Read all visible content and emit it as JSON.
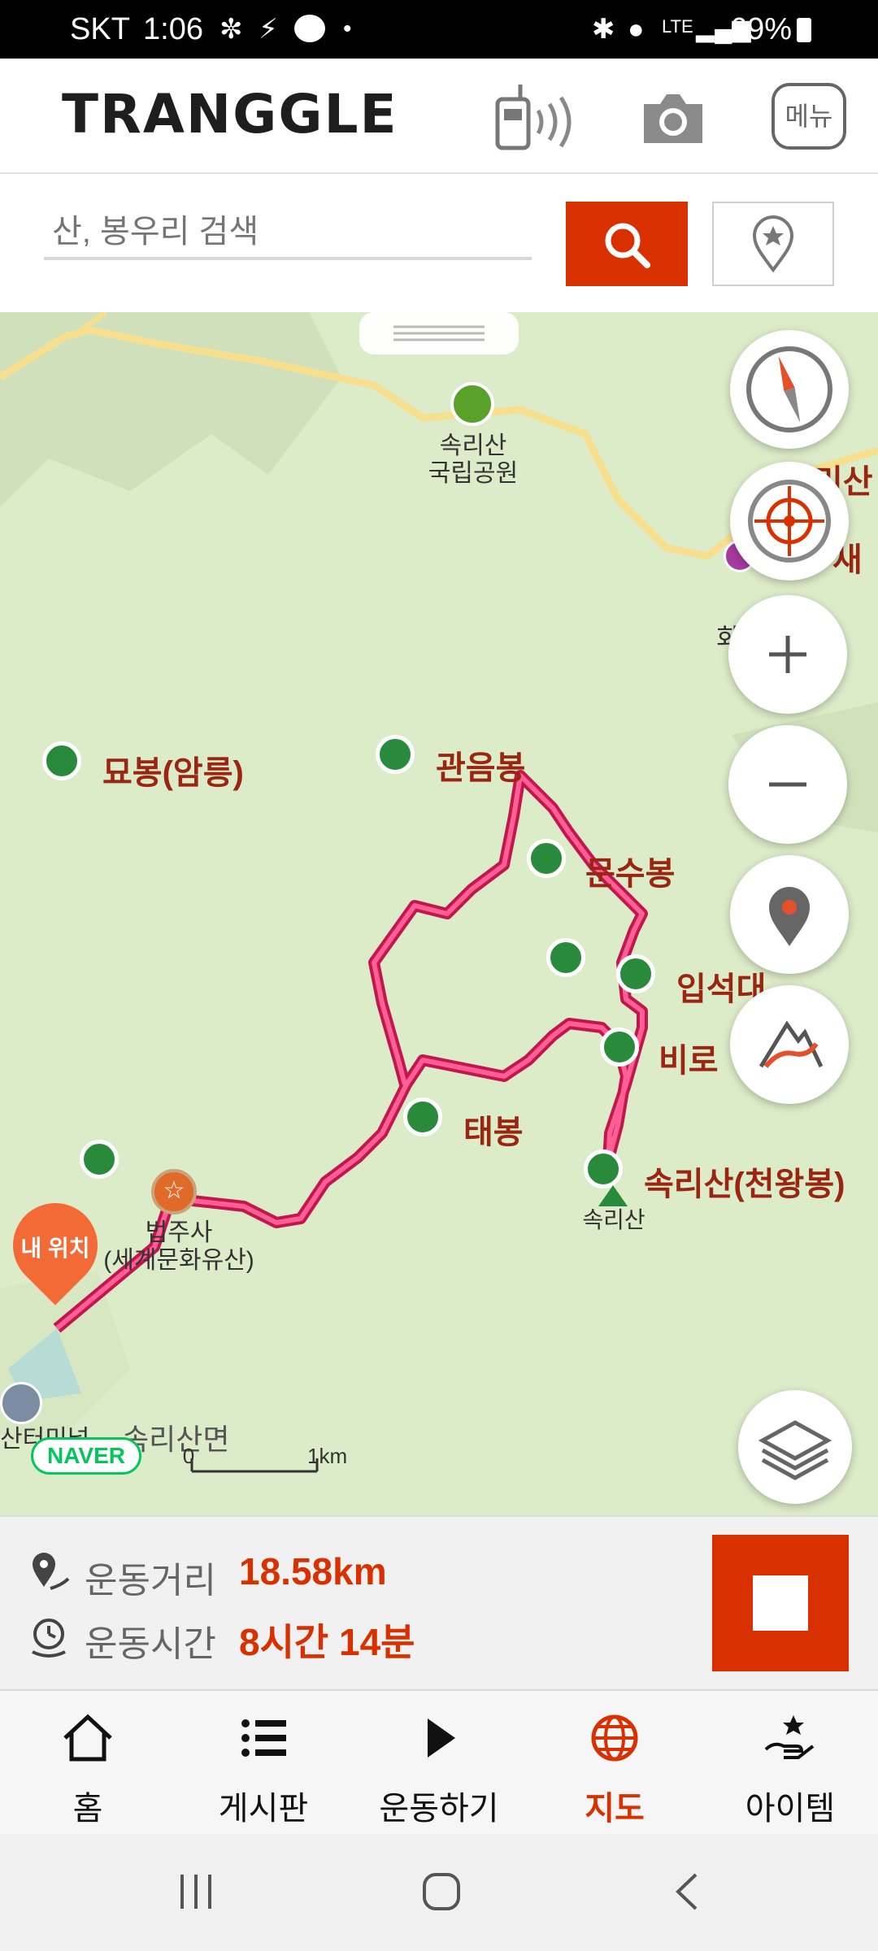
{
  "status_bar": {
    "carrier": "SKT",
    "time": "1:06",
    "network": "LTE",
    "battery": "69%"
  },
  "header": {
    "logo": "TRANGGLE",
    "menu_label": "메뉴"
  },
  "search": {
    "placeholder": "산, 봉우리 검색"
  },
  "map": {
    "park_label": "속리산\n국립공원",
    "peaks": [
      {
        "name": "묘봉(암릉)"
      },
      {
        "name": "관음봉"
      },
      {
        "name": "문수봉"
      },
      {
        "name": "입석대"
      },
      {
        "name": "비로봉"
      },
      {
        "name": "태봉"
      },
      {
        "name": "속리산(천왕봉)"
      }
    ],
    "partial_labels": {
      "top_right_1": "미산",
      "top_right_2": "새",
      "hwa": "화",
      "biro": "비로",
      "ipseok": "입석대"
    },
    "summit_label": "속리산",
    "temple_label": "법주사\n(세계문화유산)",
    "my_location": "내 위치",
    "terminal_label": "산터미널",
    "district_label": "속리산면",
    "scale_zero": "0",
    "scale_label": "1km",
    "naver": "NAVER"
  },
  "stats": {
    "distance_label": "운동거리",
    "distance_value": "18.58km",
    "time_label": "운동시간",
    "time_value": "8시간 14분"
  },
  "bottom_nav": {
    "items": [
      {
        "label": "홈",
        "icon": "home-icon"
      },
      {
        "label": "게시판",
        "icon": "list-icon"
      },
      {
        "label": "운동하기",
        "icon": "play-icon"
      },
      {
        "label": "지도",
        "icon": "globe-icon"
      },
      {
        "label": "아이템",
        "icon": "item-icon"
      }
    ],
    "active_label": "지도",
    "active_color": "#d93000"
  },
  "colors": {
    "accent": "#d93000",
    "route": "#ef2f6a",
    "map_bg": "#dcebc8"
  }
}
